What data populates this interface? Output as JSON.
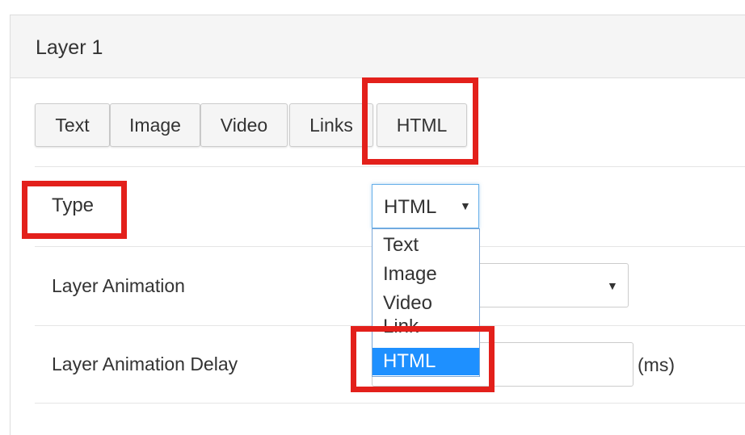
{
  "panel": {
    "title": "Layer 1"
  },
  "tabs": [
    {
      "label": "Text"
    },
    {
      "label": "Image"
    },
    {
      "label": "Video"
    },
    {
      "label": "Links"
    },
    {
      "label": "HTML"
    }
  ],
  "type_field": {
    "label": "Type",
    "selected": "HTML",
    "options": [
      "Text",
      "Image",
      "Video",
      "Link",
      "HTML"
    ],
    "highlighted_option": "HTML"
  },
  "animation_field": {
    "label": "Layer Animation",
    "value": ""
  },
  "delay_field": {
    "label": "Layer Animation Delay",
    "value": "",
    "unit": "(ms)"
  },
  "icons": {
    "dropdown_caret": "▼"
  },
  "colors": {
    "annotation_red": "#e3201b",
    "selected_option_bg": "#1e90ff",
    "focus_border": "#66afe9"
  }
}
